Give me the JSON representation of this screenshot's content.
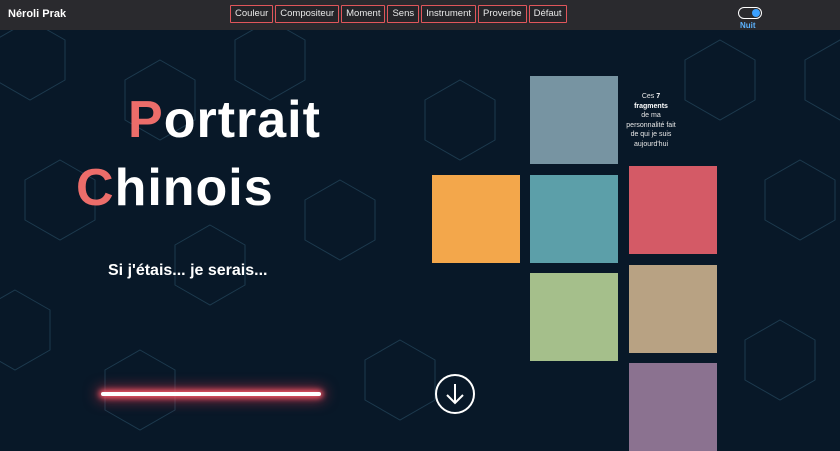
{
  "header": {
    "brand": "Néroli Prak",
    "nav": [
      "Couleur",
      "Compositeur",
      "Moment",
      "Sens",
      "Instrument",
      "Proverbe",
      "Défaut"
    ],
    "toggle_label": "Nuit",
    "toggle_on": true
  },
  "hero": {
    "title_line1_initial": "P",
    "title_line1_rest": "ortrait",
    "title_line2_initial": "C",
    "title_line2_rest": "hinois",
    "subtitle": "Si j'étais... je serais..."
  },
  "fragments": {
    "caption_prefix": "Ces",
    "count": "7",
    "caption_bold": "fragments",
    "caption_rest": "de ma personnalité fait de qui je suis aujourd'hui",
    "tiles": [
      {
        "name": "tile-slate",
        "color": "#7794a2"
      },
      {
        "name": "tile-orange",
        "color": "#f3a74b"
      },
      {
        "name": "tile-teal",
        "color": "#5c9fa9"
      },
      {
        "name": "tile-red",
        "color": "#d45a66"
      },
      {
        "name": "tile-green",
        "color": "#a5bf8b"
      },
      {
        "name": "tile-tan",
        "color": "#b8a283"
      },
      {
        "name": "tile-mauve",
        "color": "#8b7290"
      }
    ]
  },
  "scroll_icon": "arrow-down-circle-icon",
  "colors": {
    "background": "#081828",
    "accent": "#ec6d6a",
    "toggle_accent": "#3aa0ff"
  }
}
